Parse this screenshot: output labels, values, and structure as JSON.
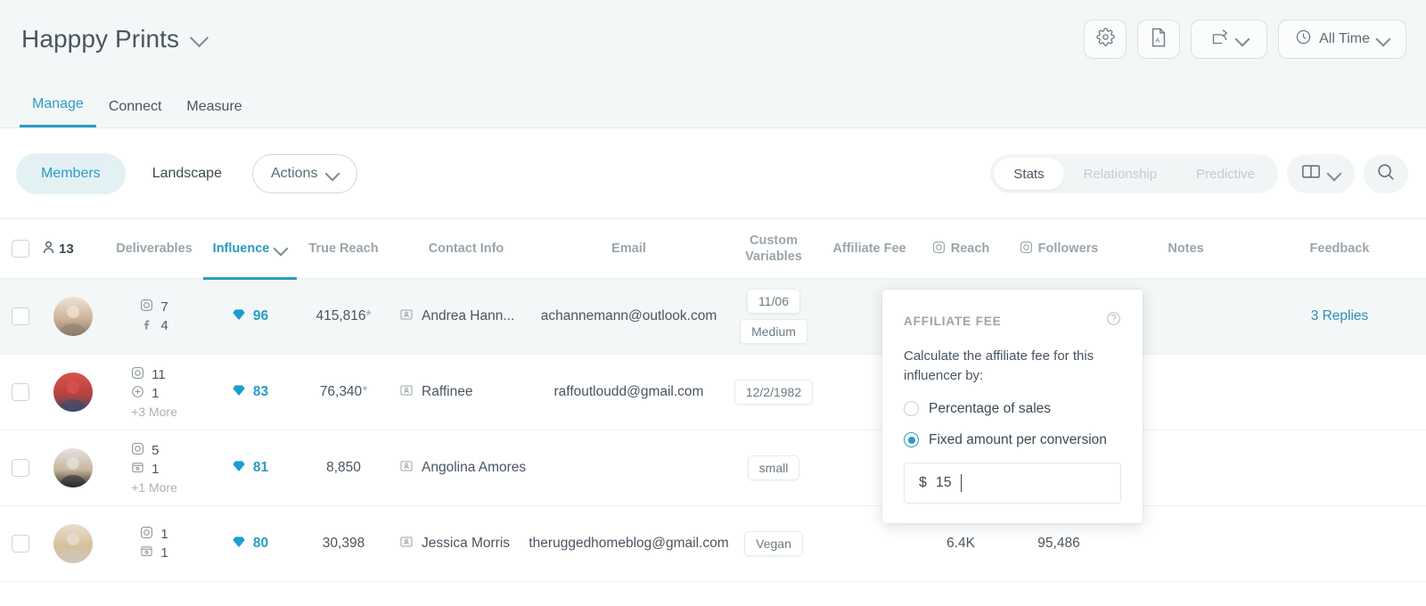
{
  "header": {
    "title": "Happpy Prints",
    "title_chevron_icon": "chevron-down-icon",
    "settings_icon": "gear-icon",
    "export_pdf_icon": "pdf-file-icon",
    "share_icon": "share-icon",
    "share_chevron_icon": "chevron-down-icon",
    "time_icon": "clock-icon",
    "time_label": "All Time",
    "time_chevron_icon": "chevron-down-icon"
  },
  "nav_tabs": [
    {
      "label": "Manage",
      "active": true
    },
    {
      "label": "Connect",
      "active": false
    },
    {
      "label": "Measure",
      "active": false
    }
  ],
  "toolbar": {
    "members_label": "Members",
    "landscape_label": "Landscape",
    "actions_label": "Actions",
    "actions_chevron_icon": "chevron-down-icon",
    "view_segments": [
      {
        "label": "Stats",
        "active": true
      },
      {
        "label": "Relationship",
        "active": false
      },
      {
        "label": "Predictive",
        "active": false
      }
    ],
    "columns_icon": "columns-layout-icon",
    "columns_chevron_icon": "chevron-down-icon",
    "search_icon": "search-icon"
  },
  "table": {
    "member_count": "13",
    "member_count_icon": "person-icon",
    "columns": [
      {
        "key": "deliverables",
        "label": "Deliverables"
      },
      {
        "key": "influence",
        "label": "Influence",
        "active": true,
        "sort_icon": "chevron-down-icon"
      },
      {
        "key": "true_reach",
        "label": "True Reach"
      },
      {
        "key": "contact_info",
        "label": "Contact Info"
      },
      {
        "key": "email",
        "label": "Email"
      },
      {
        "key": "custom_variables",
        "label_line1": "Custom",
        "label_line2": "Variables"
      },
      {
        "key": "affiliate_fee",
        "label": "Affiliate Fee"
      },
      {
        "key": "reach",
        "label": "Reach",
        "icon": "instagram-icon"
      },
      {
        "key": "followers",
        "label": "Followers",
        "icon": "instagram-icon"
      },
      {
        "key": "notes",
        "label": "Notes"
      },
      {
        "key": "feedback",
        "label": "Feedback"
      }
    ],
    "rows": [
      {
        "selected": true,
        "avatar": "family-photo-avatar",
        "deliverables": [
          {
            "icon": "instagram-icon",
            "count": "7"
          },
          {
            "icon": "facebook-icon",
            "count": "4"
          }
        ],
        "more": "",
        "influence": "96",
        "influence_icon": "diamond-icon",
        "true_reach": "415,816",
        "true_reach_star": "*",
        "contact_name": "Andrea Hann...",
        "contact_icon": "contact-card-icon",
        "email": "achannemann@outlook.com",
        "custom_variables": [
          "11/06",
          "Medium"
        ],
        "affiliate_fee": "",
        "reach": "",
        "followers": "",
        "notes": "",
        "feedback": "3 Replies"
      },
      {
        "selected": false,
        "avatar": "group-photo-avatar",
        "deliverables": [
          {
            "icon": "instagram-icon",
            "count": "11"
          },
          {
            "icon": "pinterest-icon",
            "count": "1"
          }
        ],
        "more": "+3 More",
        "influence": "83",
        "influence_icon": "diamond-icon",
        "true_reach": "76,340",
        "true_reach_star": "*",
        "contact_name": "Raffinee",
        "contact_icon": "contact-card-icon",
        "email": "raffoutloudd@gmail.com",
        "custom_variables": [
          "12/2/1982"
        ],
        "affiliate_fee": "",
        "reach": "",
        "followers": "",
        "notes": "",
        "feedback": ""
      },
      {
        "selected": false,
        "avatar": "woman-black-top-avatar",
        "deliverables": [
          {
            "icon": "instagram-icon",
            "count": "5"
          },
          {
            "icon": "story-icon",
            "count": "1"
          }
        ],
        "more": "+1 More",
        "influence": "81",
        "influence_icon": "diamond-icon",
        "true_reach": "8,850",
        "true_reach_star": "",
        "contact_name": "Angolina Amores",
        "contact_icon": "contact-card-icon",
        "email": "",
        "custom_variables": [
          "small"
        ],
        "affiliate_fee": "",
        "reach": "",
        "followers": "",
        "notes": "",
        "feedback": ""
      },
      {
        "selected": false,
        "avatar": "woman-hat-avatar",
        "deliverables": [
          {
            "icon": "instagram-icon",
            "count": "1"
          },
          {
            "icon": "story-icon",
            "count": "1"
          }
        ],
        "more": "",
        "influence": "80",
        "influence_icon": "diamond-icon",
        "true_reach": "30,398",
        "true_reach_star": "",
        "contact_name": "Jessica Morris",
        "contact_icon": "contact-card-icon",
        "email": "theruggedhomeblog@gmail.com",
        "custom_variables": [
          "Vegan"
        ],
        "affiliate_fee": "",
        "reach": "6.4K",
        "followers": "95,486",
        "notes": "",
        "feedback": ""
      }
    ]
  },
  "popover": {
    "title": "AFFILIATE FEE",
    "help_icon": "help-circle-icon",
    "description": "Calculate the affiliate fee for this influencer by:",
    "options": [
      {
        "label": "Percentage of sales",
        "selected": false
      },
      {
        "label": "Fixed amount per conversion",
        "selected": true
      }
    ],
    "currency_symbol": "$",
    "amount_value": "15"
  },
  "colors": {
    "accent": "#2b9cc4",
    "text": "#4a5560",
    "muted": "#9aa5ab",
    "header_bg": "#f4f7f7",
    "selected_row": "#f3f7f7"
  }
}
